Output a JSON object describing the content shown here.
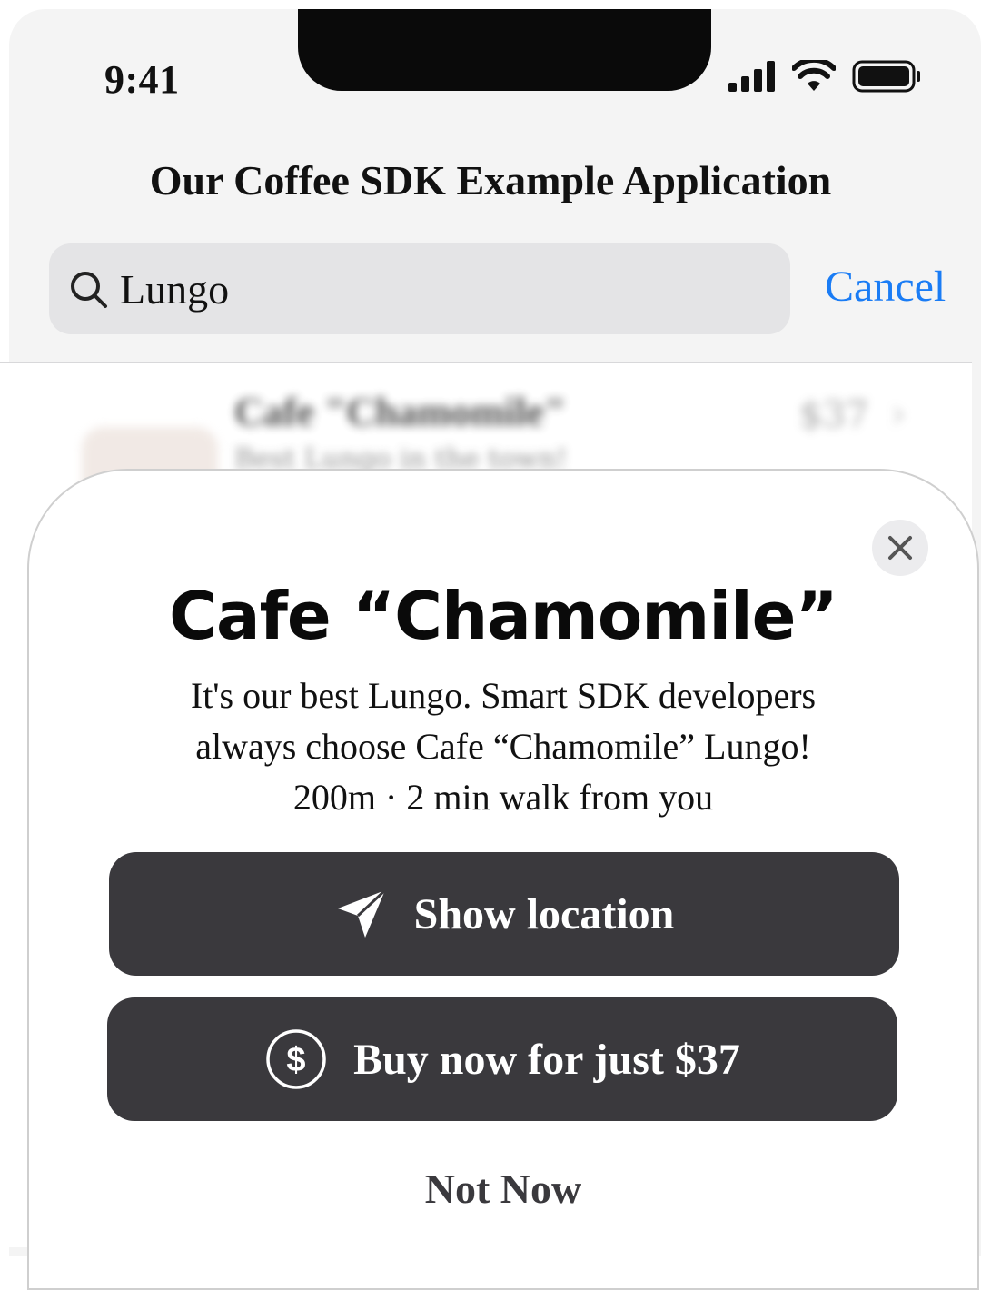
{
  "status_bar": {
    "time": "9:41",
    "icons": [
      "signal-icon",
      "wifi-icon",
      "battery-icon"
    ]
  },
  "nav": {
    "title": "Our Coffee SDK Example Application"
  },
  "search": {
    "value": "Lungo",
    "cancel_label": "Cancel"
  },
  "results": [
    {
      "title": "Cafe \"Chamomile\"",
      "subtitle": "Best Lungo in the town!",
      "price": "$37"
    }
  ],
  "sheet": {
    "title": "Cafe “Chamomile”",
    "description_lines": [
      "It's our best Lungo. Smart SDK developers",
      "always choose Cafe “Chamomile” Lungo!",
      "200m · 2 min walk from you"
    ],
    "show_location_label": "Show location",
    "buy_label": "Buy now for just $37",
    "not_now_label": "Not Now"
  },
  "colors": {
    "accent": "#1a7cf5",
    "button_bg": "#3a393d",
    "search_bg": "#e4e4e6",
    "header_bg": "#f4f4f4"
  }
}
